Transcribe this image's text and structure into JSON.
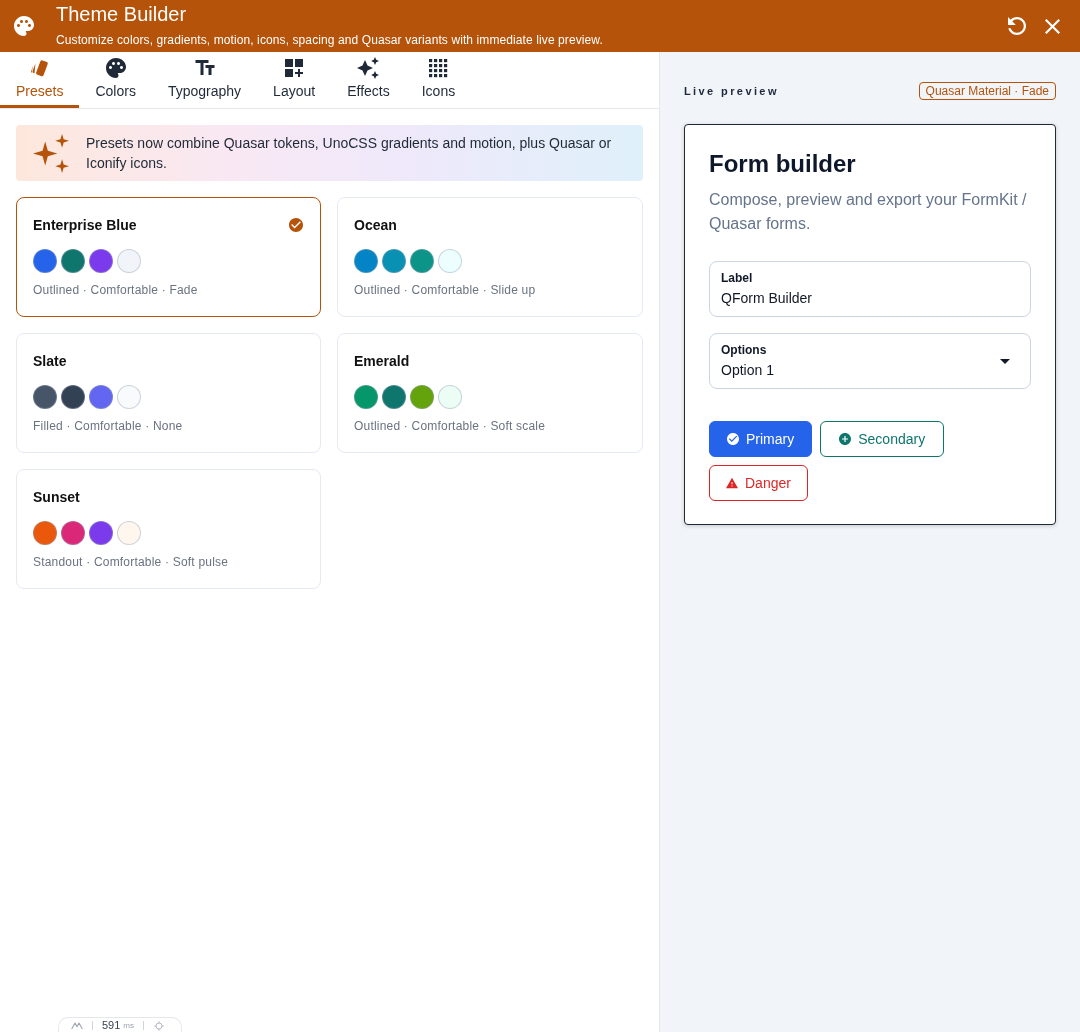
{
  "header": {
    "title": "Theme Builder",
    "subtitle": "Customize colors, gradients, motion, icons, spacing and Quasar variants with immediate live preview."
  },
  "tabs": [
    {
      "label": "Presets",
      "selected": true
    },
    {
      "label": "Colors",
      "selected": false
    },
    {
      "label": "Typography",
      "selected": false
    },
    {
      "label": "Layout",
      "selected": false
    },
    {
      "label": "Effects",
      "selected": false
    },
    {
      "label": "Icons",
      "selected": false
    }
  ],
  "banner": {
    "text": "Presets now combine Quasar tokens, UnoCSS gradients and motion, plus Quasar or Iconify icons."
  },
  "presets": [
    {
      "name": "Enterprise Blue",
      "selected": true,
      "swatches": [
        {
          "color": "#2563eb"
        },
        {
          "color": "#0f766e"
        },
        {
          "color": "#7c3aed"
        },
        {
          "color": "#f1f5f9"
        }
      ],
      "summary": "Outlined · Comfortable · Fade"
    },
    {
      "name": "Ocean",
      "selected": false,
      "swatches": [
        {
          "color": "#0284c7"
        },
        {
          "color": "#0891b2"
        },
        {
          "color": "#0d9488"
        },
        {
          "color": "#ecfeff"
        }
      ],
      "summary": "Outlined · Comfortable · Slide up"
    },
    {
      "name": "Slate",
      "selected": false,
      "swatches": [
        {
          "color": "#475569"
        },
        {
          "color": "#334155"
        },
        {
          "color": "#6366f1"
        },
        {
          "color": "#f8fafc"
        }
      ],
      "summary": "Filled · Comfortable · None"
    },
    {
      "name": "Emerald",
      "selected": false,
      "swatches": [
        {
          "color": "#059669"
        },
        {
          "color": "#0f766e"
        },
        {
          "color": "#65a30d"
        },
        {
          "color": "#ecfdf5"
        }
      ],
      "summary": "Outlined · Comfortable · Soft scale"
    },
    {
      "name": "Sunset",
      "selected": false,
      "swatches": [
        {
          "color": "#ea580c"
        },
        {
          "color": "#db2777"
        },
        {
          "color": "#7c3aed"
        },
        {
          "color": "#fff7ed"
        }
      ],
      "summary": "Standout · Comfortable · Soft pulse"
    }
  ],
  "preview": {
    "heading": "Live preview",
    "badge": "Quasar Material · Fade",
    "card": {
      "title": "Form builder",
      "description": "Compose, preview and export your FormKit / Quasar forms.",
      "fields": [
        {
          "kind": "input",
          "label": "Label",
          "value": "QForm Builder"
        },
        {
          "kind": "select",
          "label": "Options",
          "value": "Option 1"
        }
      ],
      "buttons": [
        {
          "kind": "primary",
          "label": "Primary"
        },
        {
          "kind": "secondary",
          "label": "Secondary"
        },
        {
          "kind": "danger",
          "label": "Danger"
        }
      ]
    }
  },
  "devtools": {
    "value": "591",
    "unit": "ms"
  }
}
